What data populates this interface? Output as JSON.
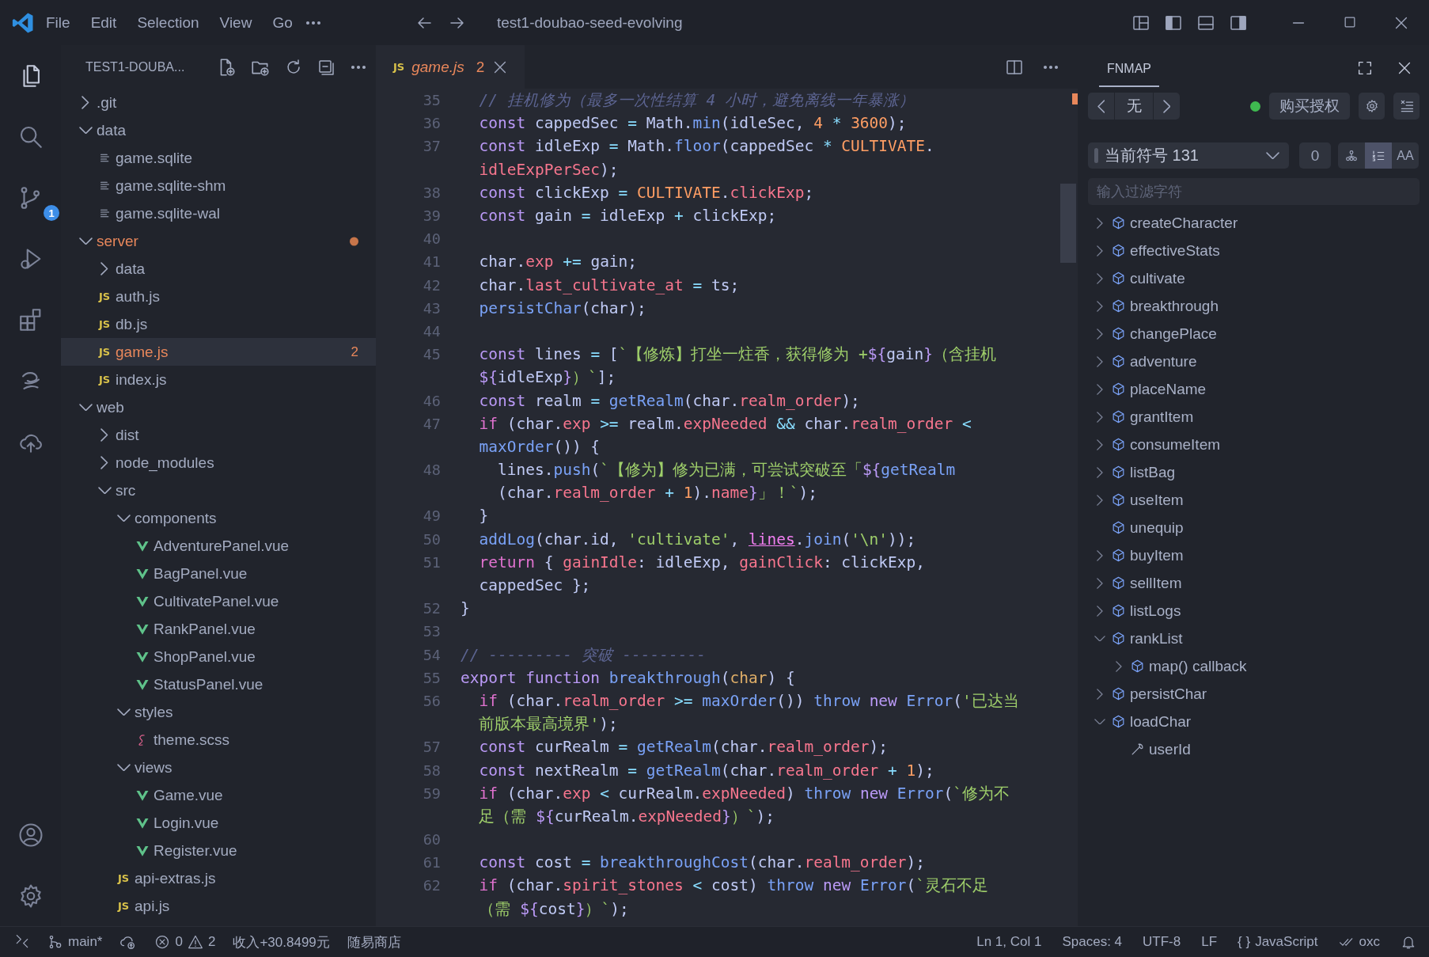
{
  "title_bar": {
    "menu": [
      "File",
      "Edit",
      "Selection",
      "View",
      "Go"
    ],
    "title": "test1-doubao-seed-evolving"
  },
  "activity_bar": {
    "items": [
      {
        "kind": "files",
        "selected": true
      },
      {
        "kind": "search",
        "selected": false
      },
      {
        "kind": "source-control",
        "selected": false,
        "badge": "1"
      },
      {
        "kind": "debug",
        "selected": false
      },
      {
        "kind": "extensions",
        "selected": false
      },
      {
        "kind": "swirl",
        "selected": false
      },
      {
        "kind": "cloud",
        "selected": false
      }
    ],
    "bottom": [
      {
        "kind": "account",
        "selected": false
      },
      {
        "kind": "settings",
        "selected": false
      }
    ]
  },
  "explorer": {
    "title": "TEST1-DOUBA...",
    "items": [
      {
        "name": ".git",
        "kind": "folder",
        "selected": false,
        "expanded": false
      },
      {
        "name": "data",
        "kind": "folder",
        "selected": false,
        "expanded": true,
        "children": [
          {
            "name": "game.sqlite",
            "kind": "db",
            "selected": false
          },
          {
            "name": "game.sqlite-shm",
            "kind": "db",
            "selected": false
          },
          {
            "name": "game.sqlite-wal",
            "kind": "db",
            "selected": false
          }
        ]
      },
      {
        "name": "server",
        "kind": "folder",
        "selected": false,
        "expanded": true,
        "problem": true,
        "dot": true,
        "children": [
          {
            "name": "data",
            "kind": "folder",
            "selected": false,
            "expanded": false
          },
          {
            "name": "auth.js",
            "kind": "js",
            "icon": "JS",
            "selected": false
          },
          {
            "name": "db.js",
            "kind": "js",
            "icon": "JS",
            "selected": false
          },
          {
            "name": "game.js",
            "kind": "js",
            "icon": "JS",
            "selected": true,
            "problem": true,
            "badge": "2"
          },
          {
            "name": "index.js",
            "kind": "js",
            "icon": "JS",
            "selected": false
          }
        ]
      },
      {
        "name": "web",
        "kind": "folder",
        "selected": false,
        "expanded": true,
        "children": [
          {
            "name": "dist",
            "kind": "folder",
            "selected": false,
            "expanded": false
          },
          {
            "name": "node_modules",
            "kind": "folder",
            "selected": false,
            "expanded": false
          },
          {
            "name": "src",
            "kind": "folder",
            "selected": false,
            "expanded": true,
            "children": [
              {
                "name": "components",
                "kind": "folder",
                "selected": false,
                "expanded": true,
                "children": [
                  {
                    "name": "AdventurePanel.vue",
                    "kind": "vue",
                    "selected": false
                  },
                  {
                    "name": "BagPanel.vue",
                    "kind": "vue",
                    "selected": false
                  },
                  {
                    "name": "CultivatePanel.vue",
                    "kind": "vue",
                    "selected": false
                  },
                  {
                    "name": "RankPanel.vue",
                    "kind": "vue",
                    "selected": false
                  },
                  {
                    "name": "ShopPanel.vue",
                    "kind": "vue",
                    "selected": false
                  },
                  {
                    "name": "StatusPanel.vue",
                    "kind": "vue",
                    "selected": false
                  }
                ]
              },
              {
                "name": "styles",
                "kind": "folder",
                "selected": false,
                "expanded": true,
                "children": [
                  {
                    "name": "theme.scss",
                    "kind": "scss",
                    "selected": false
                  }
                ]
              },
              {
                "name": "views",
                "kind": "folder",
                "selected": false,
                "expanded": true,
                "children": [
                  {
                    "name": "Game.vue",
                    "kind": "vue",
                    "selected": false
                  },
                  {
                    "name": "Login.vue",
                    "kind": "vue",
                    "selected": false
                  },
                  {
                    "name": "Register.vue",
                    "kind": "vue",
                    "selected": false
                  }
                ]
              },
              {
                "name": "api-extras.js",
                "kind": "js",
                "icon": "JS",
                "selected": false
              },
              {
                "name": "api.js",
                "kind": "js",
                "icon": "JS",
                "selected": false
              }
            ]
          }
        ]
      }
    ]
  },
  "editor": {
    "tabs": [
      {
        "icon": "JS",
        "name": "game.js",
        "problems": "2",
        "selected": true
      }
    ],
    "rows": [
      {
        "number": "35",
        "tokens": [
          {
            "kind": "cm",
            "text": "  // 挂机修为（最多一次性结算 4 小时，避免离线一年暴涨）"
          }
        ]
      },
      {
        "number": "36",
        "tokens": [
          {
            "kind": "kw",
            "text": "  const "
          },
          {
            "kind": "pl",
            "text": "cappedSec "
          },
          {
            "kind": "op",
            "text": "= "
          },
          {
            "kind": "pl",
            "text": "Math."
          },
          {
            "kind": "fn",
            "text": "min"
          },
          {
            "kind": "pl",
            "text": "(idleSec, "
          },
          {
            "kind": "num",
            "text": "4 "
          },
          {
            "kind": "op",
            "text": "* "
          },
          {
            "kind": "num",
            "text": "3600"
          },
          {
            "kind": "pl",
            "text": ");"
          }
        ]
      },
      {
        "number": "37",
        "tokens": [
          {
            "kind": "kw",
            "text": "  const "
          },
          {
            "kind": "pl",
            "text": "idleExp "
          },
          {
            "kind": "op",
            "text": "= "
          },
          {
            "kind": "pl",
            "text": "Math."
          },
          {
            "kind": "fn",
            "text": "floor"
          },
          {
            "kind": "pl",
            "text": "(cappedSec "
          },
          {
            "kind": "op",
            "text": "* "
          },
          {
            "kind": "cn",
            "text": "CULTIVATE"
          },
          {
            "kind": "pl",
            "text": "."
          }
        ]
      },
      {
        "tokens": [
          {
            "kind": "pr",
            "text": "  idleExpPerSec"
          },
          {
            "kind": "pl",
            "text": ");"
          }
        ]
      },
      {
        "number": "38",
        "tokens": [
          {
            "kind": "kw",
            "text": "  const "
          },
          {
            "kind": "pl",
            "text": "clickExp "
          },
          {
            "kind": "op",
            "text": "= "
          },
          {
            "kind": "cn",
            "text": "CULTIVATE"
          },
          {
            "kind": "pl",
            "text": "."
          },
          {
            "kind": "pr",
            "text": "clickExp"
          },
          {
            "kind": "pl",
            "text": ";"
          }
        ]
      },
      {
        "number": "39",
        "tokens": [
          {
            "kind": "kw",
            "text": "  const "
          },
          {
            "kind": "pl",
            "text": "gain "
          },
          {
            "kind": "op",
            "text": "= "
          },
          {
            "kind": "pl",
            "text": "idleExp "
          },
          {
            "kind": "op",
            "text": "+ "
          },
          {
            "kind": "pl",
            "text": "clickExp;"
          }
        ]
      },
      {
        "number": "40"
      },
      {
        "number": "41",
        "tokens": [
          {
            "kind": "pl",
            "text": "  char."
          },
          {
            "kind": "pr",
            "text": "exp "
          },
          {
            "kind": "op",
            "text": "+= "
          },
          {
            "kind": "pl",
            "text": "gain;"
          }
        ]
      },
      {
        "number": "42",
        "tokens": [
          {
            "kind": "pl",
            "text": "  char."
          },
          {
            "kind": "pr",
            "text": "last_cultivate_at "
          },
          {
            "kind": "op",
            "text": "= "
          },
          {
            "kind": "pl",
            "text": "ts;"
          }
        ]
      },
      {
        "number": "43",
        "tokens": [
          {
            "kind": "fn",
            "text": "  persistChar"
          },
          {
            "kind": "pl",
            "text": "(char);"
          }
        ]
      },
      {
        "number": "44"
      },
      {
        "number": "45",
        "tokens": [
          {
            "kind": "kw",
            "text": "  const "
          },
          {
            "kind": "pl",
            "text": "lines "
          },
          {
            "kind": "op",
            "text": "= "
          },
          {
            "kind": "pl",
            "text": "["
          },
          {
            "kind": "str",
            "text": "`【修炼】打坐一炷香，获得修为 +"
          },
          {
            "kind": "kw",
            "text": "${"
          },
          {
            "kind": "pl",
            "text": "gain"
          },
          {
            "kind": "kw",
            "text": "}"
          },
          {
            "kind": "str",
            "text": "（含挂机"
          }
        ]
      },
      {
        "tokens": [
          {
            "kind": "kw",
            "text": "  ${"
          },
          {
            "kind": "pl",
            "text": "idleExp"
          },
          {
            "kind": "kw",
            "text": "}"
          },
          {
            "kind": "str",
            "text": "）`"
          },
          {
            "kind": "pl",
            "text": "];"
          }
        ]
      },
      {
        "number": "46",
        "tokens": [
          {
            "kind": "kw",
            "text": "  const "
          },
          {
            "kind": "pl",
            "text": "realm "
          },
          {
            "kind": "op",
            "text": "= "
          },
          {
            "kind": "fn",
            "text": "getRealm"
          },
          {
            "kind": "pl",
            "text": "(char."
          },
          {
            "kind": "pr",
            "text": "realm_order"
          },
          {
            "kind": "pl",
            "text": ");"
          }
        ]
      },
      {
        "number": "47",
        "tokens": [
          {
            "kind": "ctl",
            "text": "  if "
          },
          {
            "kind": "pl",
            "text": "(char."
          },
          {
            "kind": "pr",
            "text": "exp "
          },
          {
            "kind": "op",
            "text": ">= "
          },
          {
            "kind": "pl",
            "text": "realm."
          },
          {
            "kind": "pr",
            "text": "expNeeded "
          },
          {
            "kind": "op",
            "text": "&& "
          },
          {
            "kind": "pl",
            "text": "char."
          },
          {
            "kind": "pr",
            "text": "realm_order "
          },
          {
            "kind": "op",
            "text": "<"
          }
        ]
      },
      {
        "tokens": [
          {
            "kind": "fn",
            "text": "  maxOrder"
          },
          {
            "kind": "pl",
            "text": "()) {"
          }
        ]
      },
      {
        "number": "48",
        "tokens": [
          {
            "kind": "pl",
            "text": "    lines."
          },
          {
            "kind": "fn",
            "text": "push"
          },
          {
            "kind": "pl",
            "text": "("
          },
          {
            "kind": "str",
            "text": "`【修为】修为已满，可尝试突破至「"
          },
          {
            "kind": "kw",
            "text": "${"
          },
          {
            "kind": "fn",
            "text": "getRealm"
          }
        ]
      },
      {
        "tokens": [
          {
            "kind": "pl",
            "text": "    (char."
          },
          {
            "kind": "pr",
            "text": "realm_order "
          },
          {
            "kind": "op",
            "text": "+ "
          },
          {
            "kind": "num",
            "text": "1"
          },
          {
            "kind": "pl",
            "text": ")."
          },
          {
            "kind": "pr",
            "text": "name"
          },
          {
            "kind": "kw",
            "text": "}"
          },
          {
            "kind": "str",
            "text": "」！`"
          },
          {
            "kind": "pl",
            "text": ");"
          }
        ]
      },
      {
        "number": "49",
        "tokens": [
          {
            "kind": "pl",
            "text": "  }"
          }
        ]
      },
      {
        "number": "50",
        "tokens": [
          {
            "kind": "fn",
            "text": "  addLog"
          },
          {
            "kind": "pl",
            "text": "(char.id, "
          },
          {
            "kind": "str",
            "text": "'cultivate'"
          },
          {
            "kind": "pl",
            "text": ", "
          },
          {
            "kind": "warn",
            "text": "lines"
          },
          {
            "kind": "pl",
            "text": "."
          },
          {
            "kind": "fn",
            "text": "join"
          },
          {
            "kind": "pl",
            "text": "("
          },
          {
            "kind": "str",
            "text": "'\\n'"
          },
          {
            "kind": "pl",
            "text": "));"
          }
        ]
      },
      {
        "number": "51",
        "tokens": [
          {
            "kind": "ctl",
            "text": "  return "
          },
          {
            "kind": "pl",
            "text": "{ "
          },
          {
            "kind": "pr",
            "text": "gainIdle"
          },
          {
            "kind": "pl",
            "text": ": idleExp, "
          },
          {
            "kind": "pr",
            "text": "gainClick"
          },
          {
            "kind": "pl",
            "text": ": clickExp,"
          }
        ]
      },
      {
        "tokens": [
          {
            "kind": "pl",
            "text": "  cappedSec };"
          }
        ]
      },
      {
        "number": "52",
        "tokens": [
          {
            "kind": "pl",
            "text": "}"
          }
        ]
      },
      {
        "number": "53"
      },
      {
        "number": "54",
        "tokens": [
          {
            "kind": "cm",
            "text": "// --------- 突破 ---------"
          }
        ]
      },
      {
        "number": "55",
        "tokens": [
          {
            "kind": "kw",
            "text": "export function "
          },
          {
            "kind": "fn",
            "text": "breakthrough"
          },
          {
            "kind": "pl",
            "text": "("
          },
          {
            "kind": "pa",
            "text": "char"
          },
          {
            "kind": "pl",
            "text": ") {"
          }
        ]
      },
      {
        "number": "56",
        "tokens": [
          {
            "kind": "ctl",
            "text": "  if "
          },
          {
            "kind": "pl",
            "text": "(char."
          },
          {
            "kind": "pr",
            "text": "realm_order "
          },
          {
            "kind": "op",
            "text": ">= "
          },
          {
            "kind": "fn",
            "text": "maxOrder"
          },
          {
            "kind": "pl",
            "text": "()) "
          },
          {
            "kind": "bl",
            "text": "throw "
          },
          {
            "kind": "kw",
            "text": "new "
          },
          {
            "kind": "bl",
            "text": "Error"
          },
          {
            "kind": "pl",
            "text": "("
          },
          {
            "kind": "str",
            "text": "'已达当"
          }
        ]
      },
      {
        "tokens": [
          {
            "kind": "str",
            "text": "  前版本最高境界'"
          },
          {
            "kind": "pl",
            "text": ");"
          }
        ]
      },
      {
        "number": "57",
        "tokens": [
          {
            "kind": "kw",
            "text": "  const "
          },
          {
            "kind": "pl",
            "text": "curRealm "
          },
          {
            "kind": "op",
            "text": "= "
          },
          {
            "kind": "fn",
            "text": "getRealm"
          },
          {
            "kind": "pl",
            "text": "(char."
          },
          {
            "kind": "pr",
            "text": "realm_order"
          },
          {
            "kind": "pl",
            "text": ");"
          }
        ]
      },
      {
        "number": "58",
        "tokens": [
          {
            "kind": "kw",
            "text": "  const "
          },
          {
            "kind": "pl",
            "text": "nextRealm "
          },
          {
            "kind": "op",
            "text": "= "
          },
          {
            "kind": "fn",
            "text": "getRealm"
          },
          {
            "kind": "pl",
            "text": "(char."
          },
          {
            "kind": "pr",
            "text": "realm_order "
          },
          {
            "kind": "op",
            "text": "+ "
          },
          {
            "kind": "num",
            "text": "1"
          },
          {
            "kind": "pl",
            "text": ");"
          }
        ]
      },
      {
        "number": "59",
        "tokens": [
          {
            "kind": "ctl",
            "text": "  if "
          },
          {
            "kind": "pl",
            "text": "(char."
          },
          {
            "kind": "pr",
            "text": "exp "
          },
          {
            "kind": "op",
            "text": "< "
          },
          {
            "kind": "pl",
            "text": "curRealm."
          },
          {
            "kind": "pr",
            "text": "expNeeded"
          },
          {
            "kind": "pl",
            "text": ") "
          },
          {
            "kind": "bl",
            "text": "throw "
          },
          {
            "kind": "kw",
            "text": "new "
          },
          {
            "kind": "bl",
            "text": "Error"
          },
          {
            "kind": "pl",
            "text": "("
          },
          {
            "kind": "str",
            "text": "`修为不"
          }
        ]
      },
      {
        "tokens": [
          {
            "kind": "str",
            "text": "  足（需 "
          },
          {
            "kind": "kw",
            "text": "${"
          },
          {
            "kind": "pl",
            "text": "curRealm."
          },
          {
            "kind": "pr",
            "text": "expNeeded"
          },
          {
            "kind": "kw",
            "text": "}"
          },
          {
            "kind": "str",
            "text": "）`"
          },
          {
            "kind": "pl",
            "text": ");"
          }
        ]
      },
      {
        "number": "60"
      },
      {
        "number": "61",
        "tokens": [
          {
            "kind": "kw",
            "text": "  const "
          },
          {
            "kind": "pl",
            "text": "cost "
          },
          {
            "kind": "op",
            "text": "= "
          },
          {
            "kind": "fn",
            "text": "breakthroughCost"
          },
          {
            "kind": "pl",
            "text": "(char."
          },
          {
            "kind": "pr",
            "text": "realm_order"
          },
          {
            "kind": "pl",
            "text": ");"
          }
        ]
      },
      {
        "number": "62",
        "tokens": [
          {
            "kind": "ctl",
            "text": "  if "
          },
          {
            "kind": "pl",
            "text": "(char."
          },
          {
            "kind": "pr",
            "text": "spirit_stones "
          },
          {
            "kind": "op",
            "text": "< "
          },
          {
            "kind": "pl",
            "text": "cost) "
          },
          {
            "kind": "bl",
            "text": "throw "
          },
          {
            "kind": "kw",
            "text": "new "
          },
          {
            "kind": "bl",
            "text": "Error"
          },
          {
            "kind": "pl",
            "text": "("
          },
          {
            "kind": "str",
            "text": "`灵石不足"
          }
        ]
      },
      {
        "tokens": [
          {
            "kind": "str",
            "text": "  （需 "
          },
          {
            "kind": "kw",
            "text": "${"
          },
          {
            "kind": "pl",
            "text": "cost"
          },
          {
            "kind": "kw",
            "text": "}"
          },
          {
            "kind": "str",
            "text": "）`"
          },
          {
            "kind": "pl",
            "text": ");"
          }
        ]
      }
    ]
  },
  "fnmap": {
    "title": "FNMAP",
    "current": "无",
    "buy_button": "购买授权",
    "symbol_select": "当前符号 131",
    "count": "0",
    "view_toggles": [
      {
        "kind": "tree",
        "selected": false
      },
      {
        "kind": "numbered",
        "selected": true
      },
      {
        "kind": "text",
        "label": "AA",
        "selected": false
      }
    ],
    "filter": {
      "placeholder": "输入过滤字符"
    },
    "symbols": [
      {
        "name": "createCharacter",
        "kind": "function",
        "expanded": false
      },
      {
        "name": "effectiveStats",
        "kind": "function",
        "expanded": false
      },
      {
        "name": "cultivate",
        "kind": "function",
        "expanded": false
      },
      {
        "name": "breakthrough",
        "kind": "function",
        "expanded": false
      },
      {
        "name": "changePlace",
        "kind": "function",
        "expanded": false
      },
      {
        "name": "adventure",
        "kind": "function",
        "expanded": false
      },
      {
        "name": "placeName",
        "kind": "function",
        "expanded": false
      },
      {
        "name": "grantItem",
        "kind": "function",
        "expanded": false
      },
      {
        "name": "consumeItem",
        "kind": "function",
        "expanded": false
      },
      {
        "name": "listBag",
        "kind": "function",
        "expanded": false
      },
      {
        "name": "useItem",
        "kind": "function",
        "expanded": false
      },
      {
        "name": "unequip",
        "kind": "function"
      },
      {
        "name": "buyItem",
        "kind": "function",
        "expanded": false
      },
      {
        "name": "sellItem",
        "kind": "function",
        "expanded": false
      },
      {
        "name": "listLogs",
        "kind": "function",
        "expanded": false
      },
      {
        "name": "rankList",
        "kind": "function",
        "expanded": true,
        "children": [
          {
            "name": "map() callback",
            "kind": "function",
            "expanded": false
          }
        ]
      },
      {
        "name": "persistChar",
        "kind": "function",
        "expanded": false
      },
      {
        "name": "loadChar",
        "kind": "function",
        "expanded": true,
        "children": [
          {
            "name": "userId",
            "kind": "property"
          }
        ]
      }
    ]
  },
  "status_bar": {
    "branch": "main*",
    "errors": "0",
    "warnings": "2",
    "income": "收入+30.8499元",
    "shop": "随易商店",
    "position": "Ln 1, Col 1",
    "spaces": "Spaces: 4",
    "encoding": "UTF-8",
    "eol": "LF",
    "language_icon": "{ }",
    "language": "JavaScript",
    "linter": "oxc"
  }
}
